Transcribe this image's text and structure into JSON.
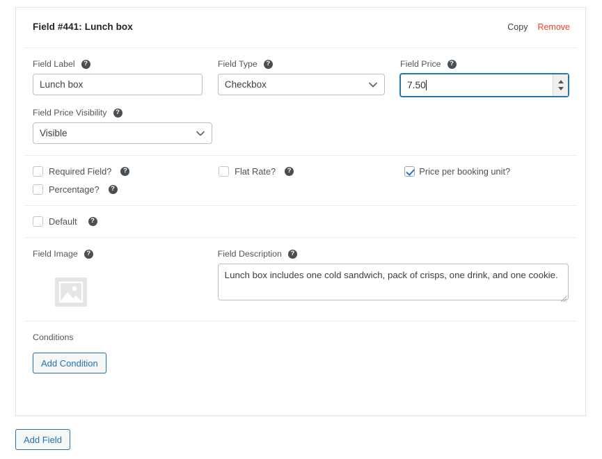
{
  "card": {
    "title": "Field #441: Lunch box",
    "actions": {
      "copy": "Copy",
      "remove": "Remove"
    }
  },
  "fields": {
    "field_label": {
      "label": "Field Label",
      "help": "?",
      "value": "Lunch box",
      "placeholder": "Field Label"
    },
    "field_type": {
      "label": "Field Type",
      "help": "?",
      "value": "Checkbox",
      "options": [
        "Checkbox"
      ]
    },
    "field_price": {
      "label": "Field Price",
      "help": "?",
      "value": "7.50",
      "focused": true
    },
    "field_price_visibility": {
      "label": "Field Price Visibility",
      "help": "?",
      "value": "Visible",
      "options": [
        "Visible"
      ]
    },
    "field_image": {
      "label": "Field Image",
      "help": "?",
      "icon": "image-placeholder-icon"
    },
    "field_description": {
      "label": "Field Description",
      "help": "?",
      "value": "Lunch box includes one cold sandwich, pack of crisps, one drink, and one cookie.",
      "placeholder": "Field Description"
    }
  },
  "checkboxes": {
    "required_field": {
      "label": "Required Field?",
      "help": "?",
      "checked": false
    },
    "flat_rate": {
      "label": "Flat Rate?",
      "help": "?",
      "checked": false
    },
    "price_per_booking_unit": {
      "label": "Price per booking unit?",
      "checked": true
    },
    "percentage": {
      "label": "Percentage?",
      "help": "?",
      "checked": false
    },
    "default": {
      "label": "Default",
      "help": "?",
      "checked": false
    }
  },
  "conditions": {
    "label": "Conditions",
    "add_button": "Add Condition"
  },
  "footer": {
    "add_field_button": "Add Field"
  },
  "colors": {
    "accent": "#2271b1",
    "danger": "#f4402f",
    "border": "#b9bfc4",
    "focus": "#2a7bb8",
    "text": "#3c434a"
  }
}
